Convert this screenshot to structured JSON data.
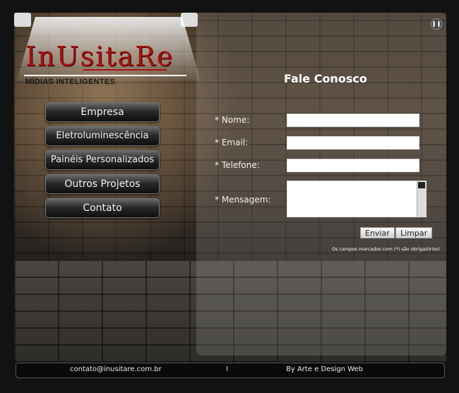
{
  "brand": {
    "name": "InUsitaRe",
    "tagline": "MÍDIAS INTELIGENTES"
  },
  "nav": {
    "items": [
      "Empresa",
      "Eletroluminescência",
      "Painéis Personalizados",
      "Outros Projetos",
      "Contato"
    ]
  },
  "form": {
    "title": "Fale Conosco",
    "name_label": "* Nome:",
    "email_label": "* Email:",
    "phone_label": "* Telefone:",
    "message_label": "* Mensagem:",
    "send": "Enviar",
    "clear": "Limpar",
    "note": "Os campos marcados com (*) são obrigatórios!"
  },
  "footer": {
    "email": "contato@inusitare.com.br",
    "sep": "I",
    "credit": "By Arte e Design Web"
  },
  "icons": {
    "pause": "pause-icon"
  }
}
